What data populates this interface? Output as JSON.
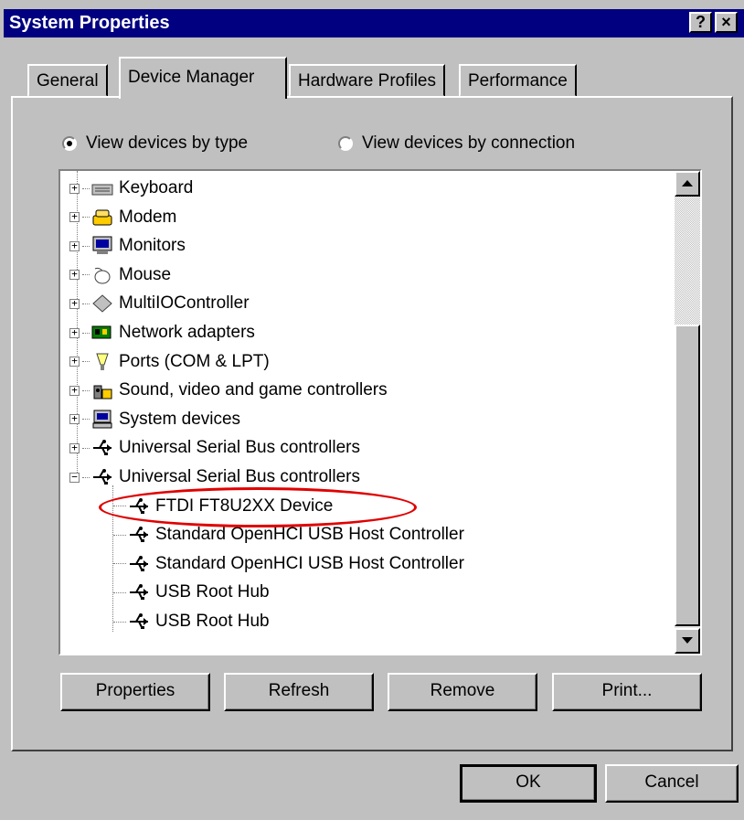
{
  "window": {
    "title": "System Properties",
    "help_label": "?",
    "close_label": "×"
  },
  "tabs": [
    {
      "label": "General",
      "active": false
    },
    {
      "label": "Device Manager",
      "active": true
    },
    {
      "label": "Hardware Profiles",
      "active": false
    },
    {
      "label": "Performance",
      "active": false
    }
  ],
  "view_options": {
    "by_type": {
      "label": "View devices by type",
      "selected": true
    },
    "by_connection": {
      "label": "View devices by connection",
      "selected": false
    }
  },
  "devices": [
    {
      "label": "Keyboard",
      "icon": "keyboard-icon",
      "expander": "+"
    },
    {
      "label": "Modem",
      "icon": "modem-icon",
      "expander": "+"
    },
    {
      "label": "Monitors",
      "icon": "monitor-icon",
      "expander": "+"
    },
    {
      "label": "Mouse",
      "icon": "mouse-icon",
      "expander": "+"
    },
    {
      "label": "MultiIOController",
      "icon": "diamond-icon",
      "expander": "+"
    },
    {
      "label": "Network adapters",
      "icon": "network-card-icon",
      "expander": "+"
    },
    {
      "label": "Ports (COM & LPT)",
      "icon": "port-icon",
      "expander": "+"
    },
    {
      "label": "Sound, video and game controllers",
      "icon": "speaker-icon",
      "expander": "+"
    },
    {
      "label": "System devices",
      "icon": "computer-icon",
      "expander": "+"
    },
    {
      "label": "Universal Serial Bus controllers",
      "icon": "usb-icon",
      "expander": "+"
    },
    {
      "label": "Universal Serial Bus controllers",
      "icon": "usb-icon",
      "expander": "−"
    }
  ],
  "usb_children": [
    {
      "label": "FTDI FT8U2XX Device",
      "icon": "usb-icon"
    },
    {
      "label": "Standard OpenHCI USB Host Controller",
      "icon": "usb-icon"
    },
    {
      "label": "Standard OpenHCI USB Host Controller",
      "icon": "usb-icon"
    },
    {
      "label": "USB Root Hub",
      "icon": "usb-icon"
    },
    {
      "label": "USB Root Hub",
      "icon": "usb-icon"
    }
  ],
  "buttons": {
    "properties": "Properties",
    "refresh": "Refresh",
    "remove": "Remove",
    "print": "Print...",
    "ok": "OK",
    "cancel": "Cancel"
  },
  "colors": {
    "titlebar": "#000080",
    "face": "#c0c0c0",
    "highlight_ellipse": "#e00000"
  }
}
